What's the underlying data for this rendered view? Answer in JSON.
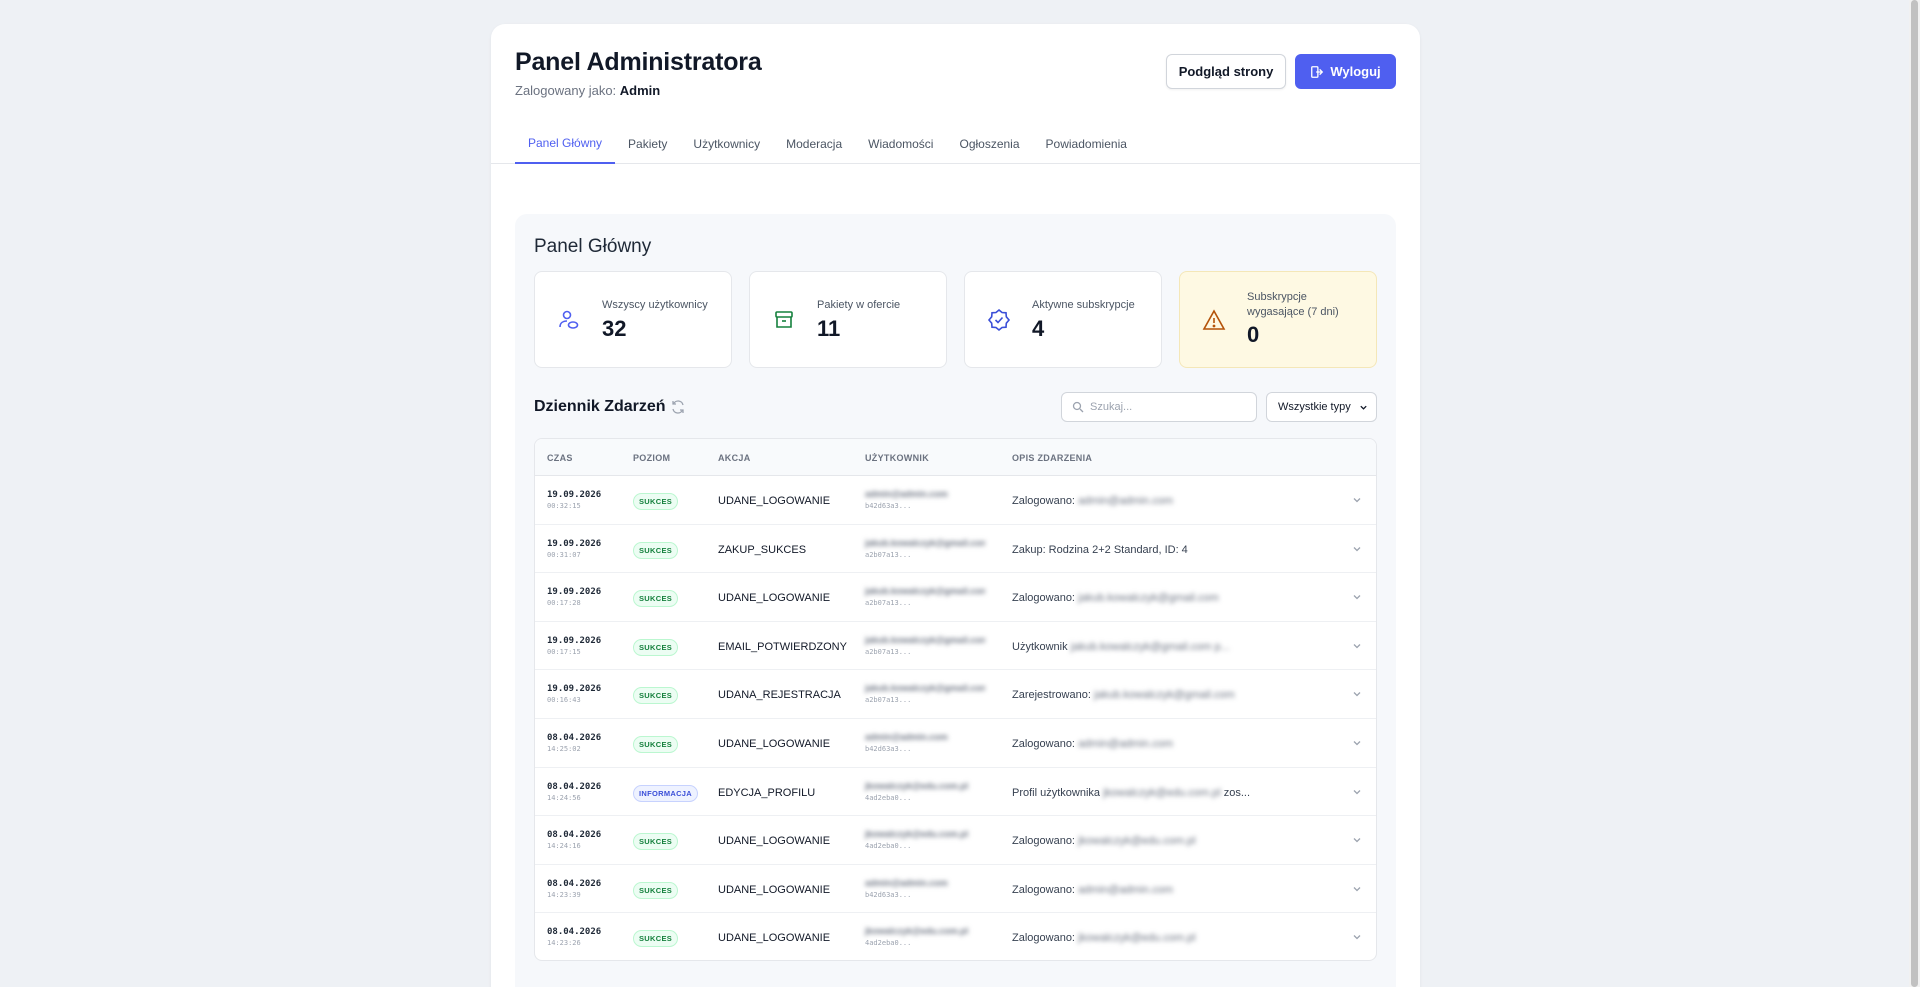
{
  "header": {
    "title": "Panel Administratora",
    "logged_prefix": "Zalogowany jako:",
    "logged_user": "Admin",
    "preview_label": "Podgląd strony",
    "logout_label": "Wyloguj"
  },
  "tabs": [
    "Panel Główny",
    "Pakiety",
    "Użytkownicy",
    "Moderacja",
    "Wiadomości",
    "Ogłoszenia",
    "Powiadomienia"
  ],
  "section_title": "Panel Główny",
  "stats": [
    {
      "label": "Wszyscy użytkownicy",
      "value": "32",
      "icon": "users-icon"
    },
    {
      "label": "Pakiety w ofercie",
      "value": "11",
      "icon": "archive-box-icon"
    },
    {
      "label": "Aktywne subskrypcje",
      "value": "4",
      "icon": "badge-check-icon"
    },
    {
      "label": "Subskrypcje wygasające (7 dni)",
      "value": "0",
      "icon": "warning-triangle-icon"
    }
  ],
  "log": {
    "title": "Dziennik Zdarzeń",
    "search_placeholder": "Szukaj...",
    "filter_value": "Wszystkie typy",
    "columns": [
      "CZAS",
      "POZIOM",
      "AKCJA",
      "UŻYTKOWNIK",
      "OPIS ZDARZENIA"
    ],
    "rows": [
      {
        "date": "19.09.2026",
        "time": "00:32:15",
        "level": "SUKCES",
        "action": "UDANE_LOGOWANIE",
        "user": "admin@admin.com",
        "user_id": "b42d63a3...",
        "desc": "Zalogowano:",
        "desc_blur": "admin@admin.com"
      },
      {
        "date": "19.09.2026",
        "time": "00:31:07",
        "level": "SUKCES",
        "action": "ZAKUP_SUKCES",
        "user": "jakub.kowalczyk@gmail.com",
        "user_id": "a2b07a13...",
        "desc": "Zakup: Rodzina 2+2 Standard, ID: 4",
        "desc_blur": ""
      },
      {
        "date": "19.09.2026",
        "time": "00:17:28",
        "level": "SUKCES",
        "action": "UDANE_LOGOWANIE",
        "user": "jakub.kowalczyk@gmail.com",
        "user_id": "a2b07a13...",
        "desc": "Zalogowano:",
        "desc_blur": "jakub.kowalczyk@gmail.com"
      },
      {
        "date": "19.09.2026",
        "time": "00:17:15",
        "level": "SUKCES",
        "action": "EMAIL_POTWIERDZONY",
        "user": "jakub.kowalczyk@gmail.com",
        "user_id": "a2b07a13...",
        "desc": "Użytkownik",
        "desc_blur": "jakub.kowalczyk@gmail.com p..."
      },
      {
        "date": "19.09.2026",
        "time": "00:16:43",
        "level": "SUKCES",
        "action": "UDANA_REJESTRACJA",
        "user": "jakub.kowalczyk@gmail.com",
        "user_id": "a2b07a13...",
        "desc": "Zarejestrowano:",
        "desc_blur": "jakub.kowalczyk@gmail.com"
      },
      {
        "date": "08.04.2026",
        "time": "14:25:02",
        "level": "SUKCES",
        "action": "UDANE_LOGOWANIE",
        "user": "admin@admin.com",
        "user_id": "b42d63a3...",
        "desc": "Zalogowano:",
        "desc_blur": "admin@admin.com"
      },
      {
        "date": "08.04.2026",
        "time": "14:24:56",
        "level": "INFORMACJA",
        "action": "EDYCJA_PROFILU",
        "user": "jkowalczyk@edu.com.pl",
        "user_id": "4ad2eba0...",
        "desc": "Profil użytkownika",
        "desc_blur": "jkowalczyk@edu.com.pl",
        "desc_tail": "zos..."
      },
      {
        "date": "08.04.2026",
        "time": "14:24:16",
        "level": "SUKCES",
        "action": "UDANE_LOGOWANIE",
        "user": "jkowalczyk@edu.com.pl",
        "user_id": "4ad2eba0...",
        "desc": "Zalogowano:",
        "desc_blur": "jkowalczyk@edu.com.pl"
      },
      {
        "date": "08.04.2026",
        "time": "14:23:39",
        "level": "SUKCES",
        "action": "UDANE_LOGOWANIE",
        "user": "admin@admin.com",
        "user_id": "b42d63a3...",
        "desc": "Zalogowano:",
        "desc_blur": "admin@admin.com"
      },
      {
        "date": "08.04.2026",
        "time": "14:23:26",
        "level": "SUKCES",
        "action": "UDANE_LOGOWANIE",
        "user": "jkowalczyk@edu.com.pl",
        "user_id": "4ad2eba0...",
        "desc": "Zalogowano:",
        "desc_blur": "jkowalczyk@edu.com.pl"
      }
    ]
  },
  "colors": {
    "accent": "#4f5ff0",
    "success": "#15803d",
    "info": "#3b4fd8",
    "warning_bg": "#fef9e3"
  }
}
